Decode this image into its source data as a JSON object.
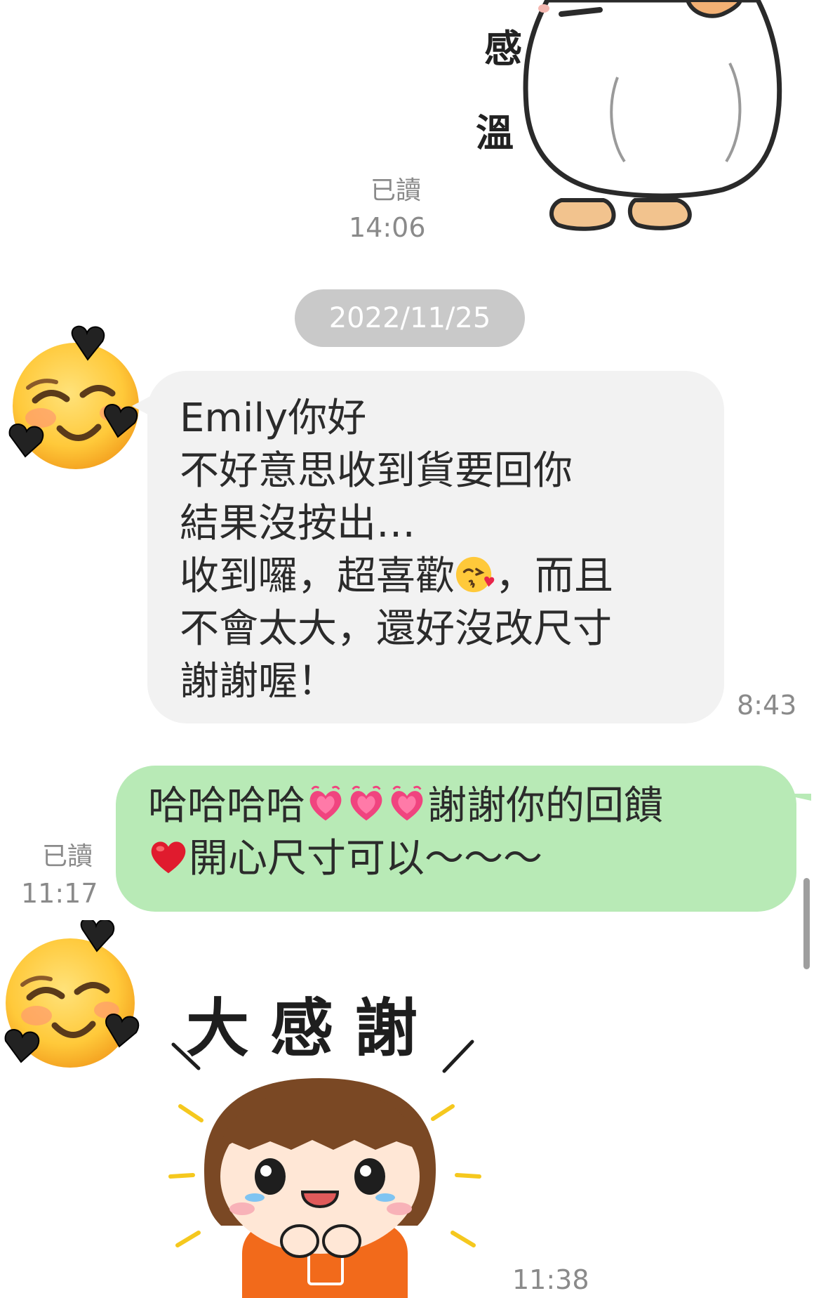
{
  "top_sticker": {
    "icon": "duck-sticker-icon",
    "text_char_1": "感",
    "text_char_2": "溫"
  },
  "top_message": {
    "read_status": "已讀",
    "time": "14:06"
  },
  "date_separator": "2022/11/25",
  "incoming_message": {
    "avatar_icon": "smiling-face-with-hearts-icon",
    "lines": [
      "Emily你好",
      "不好意思收到貨要回你",
      "結果沒按出…",
      "收到囉，超喜歡",
      "，而且",
      "不會太大，還好沒改尺寸",
      "謝謝喔！"
    ],
    "inline_emoji": "face-blowing-kiss-icon",
    "time": "8:43"
  },
  "outgoing_message": {
    "line_1_prefix": "哈哈哈哈",
    "line_1_suffix": "謝謝你的回饋",
    "line_2": "開心尺寸可以～～～",
    "inline_emojis": [
      "growing-heart-icon",
      "growing-heart-icon",
      "growing-heart-icon",
      "red-heart-icon"
    ],
    "read_status": "已讀",
    "time": "11:17"
  },
  "bottom_message": {
    "avatar_icon": "smiling-face-with-hearts-icon",
    "sticker_icon": "big-thanks-girl-sticker-icon",
    "sticker_text": "大感謝",
    "time": "11:38"
  },
  "colors": {
    "background": "#FFFFFF",
    "incoming_bubble": "#F2F2F2",
    "outgoing_bubble": "#B8EAB6",
    "date_chip": "#C9C9C9",
    "meta_text": "#8A8A8A",
    "message_text": "#2B2B2B"
  }
}
